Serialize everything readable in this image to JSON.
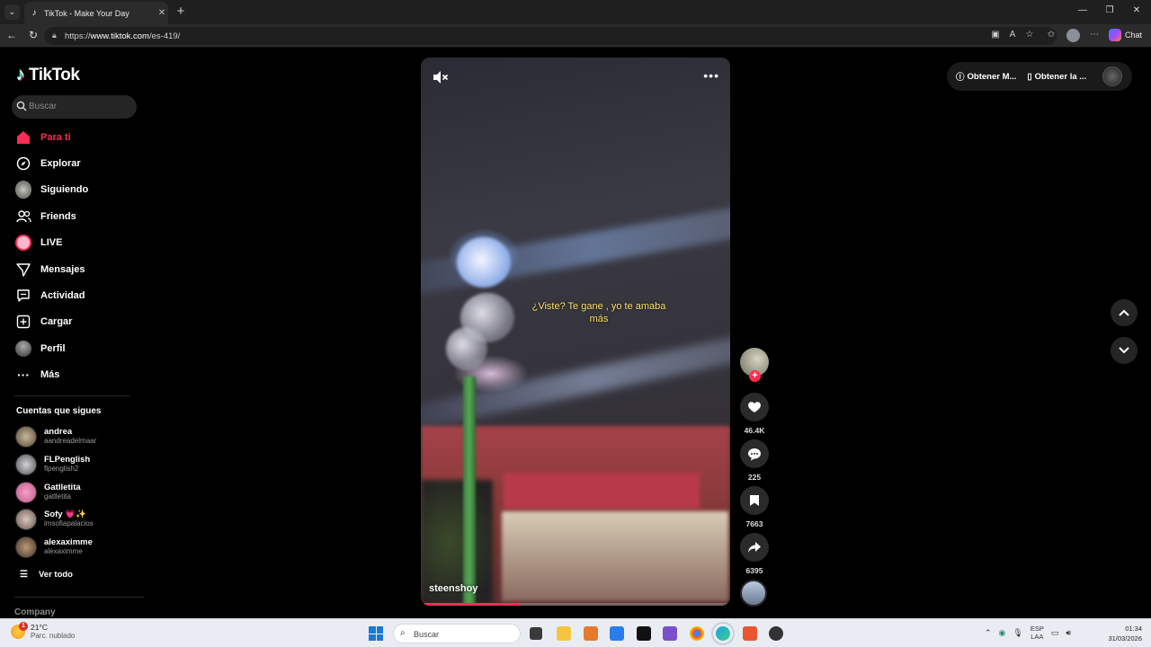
{
  "browser": {
    "tab_title": "TikTok - Make Your Day",
    "url_prefix": "https://",
    "url_host": "www.tiktok.com",
    "url_path": "/es-419/",
    "copilot_label": "Chat"
  },
  "sidebar": {
    "logo_text": "TikTok",
    "search_placeholder": "Buscar",
    "nav": [
      {
        "label": "Para ti",
        "icon": "home-icon"
      },
      {
        "label": "Explorar",
        "icon": "compass-icon"
      },
      {
        "label": "Siguiendo",
        "icon": "following-avatar-icon"
      },
      {
        "label": "Friends",
        "icon": "friends-icon"
      },
      {
        "label": "LIVE",
        "icon": "live-icon"
      },
      {
        "label": "Mensajes",
        "icon": "messages-icon"
      },
      {
        "label": "Actividad",
        "icon": "activity-icon"
      },
      {
        "label": "Cargar",
        "icon": "upload-icon"
      },
      {
        "label": "Perfil",
        "icon": "profile-avatar-icon"
      },
      {
        "label": "Más",
        "icon": "more-icon"
      }
    ],
    "following_title": "Cuentas que sigues",
    "accounts": [
      {
        "name": "andrea",
        "handle": "aandreadelmaar"
      },
      {
        "name": "FLPenglish",
        "handle": "flpenglish2"
      },
      {
        "name": "Gatlletita",
        "handle": "gatlletita"
      },
      {
        "name": "Sofy 💗✨",
        "handle": "imsofiapalacios"
      },
      {
        "name": "alexaximme",
        "handle": "alexaximme"
      }
    ],
    "see_all": "Ver todo",
    "company": "Company"
  },
  "video": {
    "caption": "¿Viste? Te gane , yo te amaba más",
    "author": "steenshoy",
    "progress": 0.32
  },
  "actions": {
    "likes": "46.4K",
    "comments": "225",
    "saves": "7663",
    "shares": "6395"
  },
  "topbar": {
    "get_coins": "Obtener M...",
    "get_app": "Obtener la ..."
  },
  "taskbar": {
    "weather_temp": "21°C",
    "weather_desc": "Parc. nublado",
    "weather_badge": "1",
    "search_placeholder": "Buscar",
    "lang_top": "ESP",
    "lang_bottom": "LAA",
    "time": "01:34",
    "date": "31/03/2026"
  },
  "colors": {
    "accent": "#fe2c55",
    "caption": "#ffe36a"
  }
}
